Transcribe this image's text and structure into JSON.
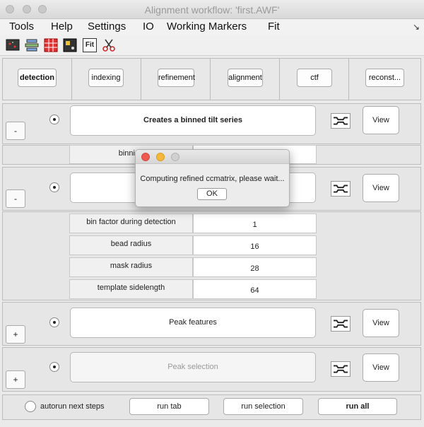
{
  "window": {
    "title": "Alignment workflow: 'first.AWF'"
  },
  "menu": [
    "Tools",
    "Help",
    "Settings",
    "IO",
    "Working Markers",
    "Fit"
  ],
  "toolbar": {
    "icons": [
      "screen-icon",
      "stack-icon",
      "grid-icon",
      "marker-icon",
      "fit-icon",
      "scissors-icon"
    ],
    "fit_label": "Fit"
  },
  "tabs": [
    "detection",
    "indexing",
    "refinement",
    "alignment",
    "ctf",
    "reconst..."
  ],
  "sections": {
    "binned_tilt": {
      "toggle": "-",
      "description": "Creates a binned tilt series",
      "view": "View",
      "param_label": "binning"
    },
    "detection": {
      "toggle": "-",
      "view": "View",
      "params": [
        {
          "label": "bin factor during detection",
          "value": "1"
        },
        {
          "label": "bead radius",
          "value": "16"
        },
        {
          "label": "mask radius",
          "value": "28"
        },
        {
          "label": "template sidelength",
          "value": "64"
        }
      ]
    },
    "peak_features": {
      "toggle": "+",
      "description": "Peak features",
      "view": "View"
    },
    "peak_selection": {
      "toggle": "+",
      "description": "Peak selection",
      "view": "View"
    }
  },
  "bottom": {
    "autorun_label": "autorun next steps",
    "run_tab": "run tab",
    "run_selection": "run selection",
    "run_all": "run all"
  },
  "dialog": {
    "message": "Computing refined ccmatrix, please wait...",
    "ok": "OK"
  }
}
